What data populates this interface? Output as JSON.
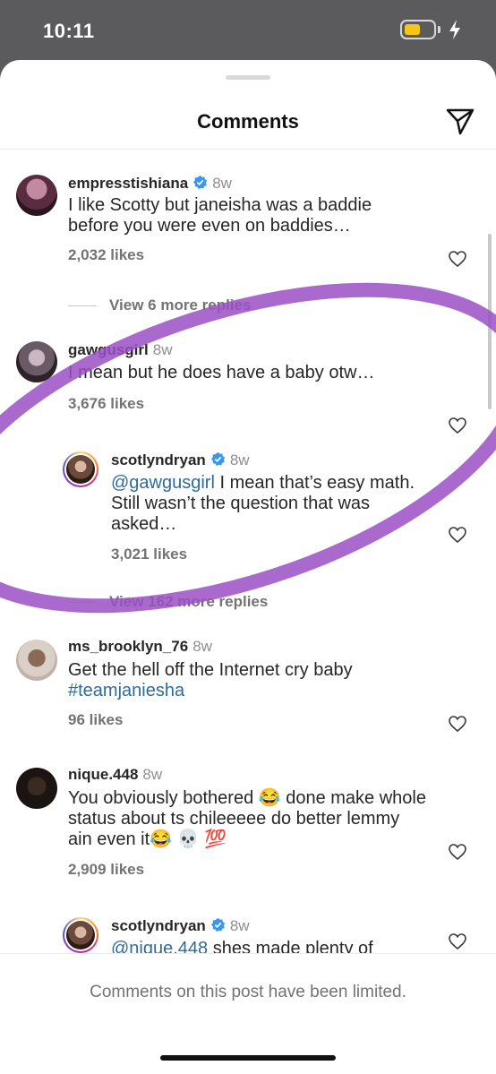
{
  "status_bar": {
    "time": "10:11",
    "battery_level": 0.55,
    "battery_color": "#f5c518",
    "charging_icon": "bolt-icon"
  },
  "sheet": {
    "title": "Comments",
    "share_icon": "paper-plane-icon"
  },
  "comments": [
    {
      "username": "empresstishiana",
      "verified": true,
      "time": "8w",
      "text": "I like Scotty but janeisha was a baddie before you were even on baddies…",
      "likes": "2,032 likes",
      "view_replies": "View 6 more replies"
    },
    {
      "username": "gawgusgirl",
      "verified": false,
      "time": "8w",
      "text": "I mean but he does have a baby otw…",
      "likes": "3,676 likes"
    },
    {
      "username": "scotlyndryan",
      "verified": true,
      "time": "8w",
      "mention": "@gawgusgirl",
      "text": " I mean that’s easy math. Still wasn’t the question that was asked…",
      "likes": "3,021 likes",
      "view_replies": "View 162 more replies"
    },
    {
      "username": "ms_brooklyn_76",
      "verified": false,
      "time": "8w",
      "text": "Get the hell off the Internet cry baby ",
      "hashtag": "#teamjaniesha",
      "likes": "96 likes"
    },
    {
      "username": "nique.448",
      "verified": false,
      "time": "8w",
      "text": "You obviously bothered 😂 done make whole status about ts chileeeee do better lemmy ain even it😂 💀 💯",
      "likes": "2,909 likes"
    },
    {
      "username": "scotlyndryan",
      "verified": true,
      "time": "8w",
      "mention": "@nique.448",
      "text": " shes made plenty of"
    }
  ],
  "footer": {
    "text": "Comments on this post have been limited."
  },
  "colors": {
    "accent_link": "#2f6b9a",
    "verified_blue": "#3897f0",
    "annotation_purple": "#9b4fc4"
  }
}
